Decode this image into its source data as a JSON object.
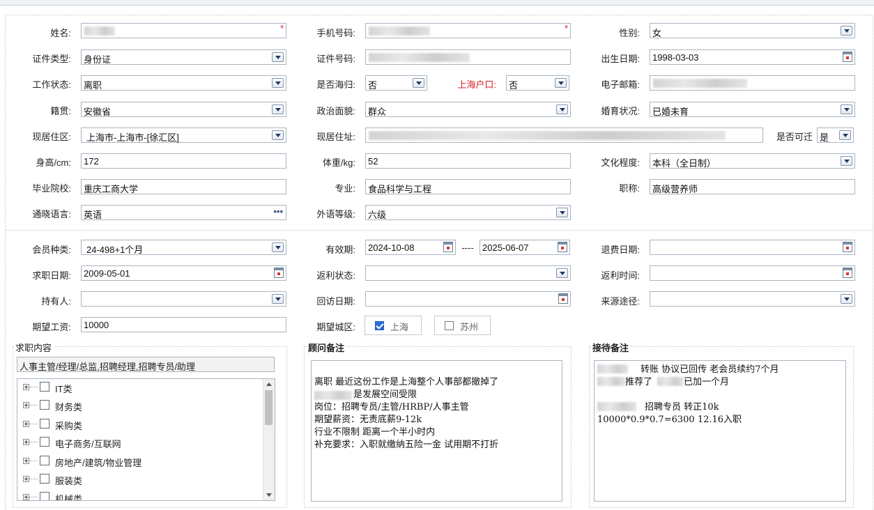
{
  "form": {
    "name": {
      "label": "姓名:",
      "required": "*"
    },
    "phone": {
      "label": "手机号码:",
      "required": "*"
    },
    "gender": {
      "label": "性别:",
      "value": "女"
    },
    "id_type": {
      "label": "证件类型:",
      "value": "身份证"
    },
    "id_number": {
      "label": "证件号码:"
    },
    "birthdate": {
      "label": "出生日期:",
      "value": "1998-03-03"
    },
    "work_status": {
      "label": "工作状态:",
      "value": "离职"
    },
    "returnee": {
      "label": "是否海归:",
      "value": "否"
    },
    "shanghai_hukou": {
      "label": "上海户口:",
      "value": "否"
    },
    "email": {
      "label": "电子邮箱:"
    },
    "native_place": {
      "label": "籍贯:",
      "value": "安徽省"
    },
    "political": {
      "label": "政治面貌:",
      "value": "群众"
    },
    "marital": {
      "label": "婚育状况:",
      "value": "已婚未育"
    },
    "residence_area": {
      "label": "现居住区:",
      "value": "上海市-上海市-[徐汇区]"
    },
    "residence_addr": {
      "label": "现居住址:"
    },
    "relocatable": {
      "label": "是否可迁",
      "value": "是"
    },
    "height": {
      "label": "身高/cm:",
      "value": "172"
    },
    "weight": {
      "label": "体重/kg:",
      "value": "52"
    },
    "education": {
      "label": "文化程度:",
      "value": "本科（全日制）"
    },
    "school": {
      "label": "毕业院校:",
      "value": "重庆工商大学"
    },
    "major": {
      "label": "专业:",
      "value": "食品科学与工程"
    },
    "title": {
      "label": "职称:",
      "value": "高级营养师"
    },
    "language": {
      "label": "通晓语言:",
      "value": "英语",
      "more": "•••"
    },
    "language_level": {
      "label": "外语等级:",
      "value": "六级"
    },
    "member_type": {
      "label": "会员种类:",
      "value": "24-498+1个月"
    },
    "valid_period": {
      "label": "有效期:",
      "start": "2024-10-08",
      "sep": "----",
      "end": "2025-06-07"
    },
    "refund_date": {
      "label": "退费日期:",
      "value": ""
    },
    "job_date": {
      "label": "求职日期:",
      "value": "2009-05-01"
    },
    "rebate_status": {
      "label": "返利状态:",
      "value": ""
    },
    "rebate_time": {
      "label": "返利时间:",
      "value": ""
    },
    "holder": {
      "label": "持有人:",
      "value": ""
    },
    "revisit_date": {
      "label": "回访日期:",
      "value": ""
    },
    "source": {
      "label": "来源途径:",
      "value": ""
    },
    "expected_salary": {
      "label": "期望工资:",
      "value": "10000"
    },
    "expected_city": {
      "label": "期望城区:",
      "options": [
        {
          "label": "上海",
          "checked": true
        },
        {
          "label": "苏州",
          "checked": false
        }
      ]
    }
  },
  "job_panel": {
    "title": "求职内容",
    "selected": "人事主管/经理/总监,招聘经理,招聘专员/助理",
    "tree": [
      "IT类",
      "财务类",
      "采购类",
      "电子商务/互联网",
      "房地产/建筑/物业管理",
      "服装类",
      "机械类"
    ]
  },
  "advisor_panel": {
    "title": "顾问备注",
    "lines": [
      "",
      "离职 最近这份工作是上海整个人事部都撤掉了",
      "是发展空间受限",
      "岗位：招聘专员/主管/HRBP/人事主管",
      "期望薪资：无责底薪9-12k",
      "行业不限制 距离一个半小时内",
      "补充要求：入职就缴纳五险一金 试用期不打折"
    ]
  },
  "reception_panel": {
    "title": "接待备注",
    "lines": [
      "转账  协议已回传  老会员续约7个月",
      "推荐了",
      "已加一个月",
      "",
      "招聘专员 转正10k",
      "10000*0.9*0.7=6300  12.16入职"
    ]
  }
}
